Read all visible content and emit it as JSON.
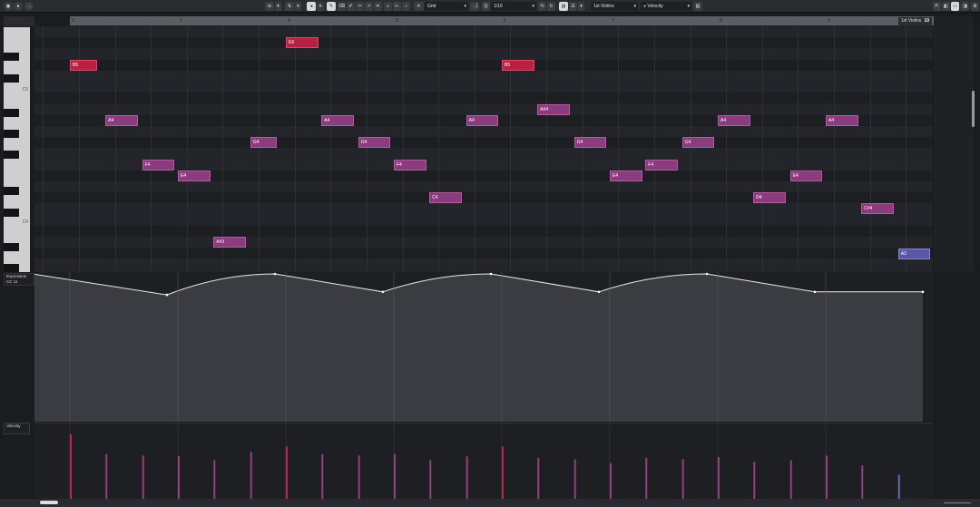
{
  "toolbar": {
    "quantize_value": "Grid",
    "quantize_length": "1/16",
    "track_name": "1st Violins",
    "lane_parameter": "Velocity",
    "active_tool": "draw"
  },
  "ruler": {
    "bars": [
      "2",
      "3",
      "4",
      "5",
      "6",
      "7",
      "8",
      "9"
    ],
    "track_tag_name": "1st Violins",
    "track_tag_number": "10"
  },
  "piano": {
    "labels": [
      "C5",
      "C4"
    ]
  },
  "notes": [
    {
      "label": "B5",
      "bar": 2.0,
      "len": 0.25,
      "pitch": "B5",
      "row": 3.5,
      "color": "red"
    },
    {
      "label": "A4",
      "bar": 2.33,
      "len": 0.3,
      "pitch": "A4",
      "row": 8.5,
      "color": "purple"
    },
    {
      "label": "F4",
      "bar": 2.67,
      "len": 0.3,
      "pitch": "F4",
      "row": 12.5,
      "color": "purple"
    },
    {
      "label": "E4",
      "bar": 3.0,
      "len": 0.3,
      "pitch": "E4",
      "row": 13.5,
      "color": "purple"
    },
    {
      "label": "A#3",
      "bar": 3.33,
      "len": 0.3,
      "pitch": "A#3",
      "row": 19.5,
      "color": "purple"
    },
    {
      "label": "G4",
      "bar": 3.67,
      "len": 0.25,
      "pitch": "G4",
      "row": 10.5,
      "color": "purple"
    },
    {
      "label": "E6",
      "bar": 4.0,
      "len": 0.3,
      "pitch": "E6",
      "row": 1.5,
      "color": "red"
    },
    {
      "label": "A4",
      "bar": 4.33,
      "len": 0.3,
      "pitch": "A4",
      "row": 8.5,
      "color": "purple"
    },
    {
      "label": "G4",
      "bar": 4.67,
      "len": 0.3,
      "pitch": "G4",
      "row": 10.5,
      "color": "purple"
    },
    {
      "label": "F4",
      "bar": 5.0,
      "len": 0.3,
      "pitch": "F4",
      "row": 12.5,
      "color": "purple"
    },
    {
      "label": "C4",
      "bar": 5.33,
      "len": 0.3,
      "pitch": "C4",
      "row": 15.5,
      "color": "purple"
    },
    {
      "label": "A4",
      "bar": 5.67,
      "len": 0.3,
      "pitch": "A4",
      "row": 8.5,
      "color": "purple"
    },
    {
      "label": "B5",
      "bar": 6.0,
      "len": 0.3,
      "pitch": "B5",
      "row": 3.5,
      "color": "red"
    },
    {
      "label": "A#4",
      "bar": 6.33,
      "len": 0.3,
      "pitch": "A#4",
      "row": 7.5,
      "color": "purple"
    },
    {
      "label": "G4",
      "bar": 6.67,
      "len": 0.3,
      "pitch": "G4",
      "row": 10.5,
      "color": "purple"
    },
    {
      "label": "E4",
      "bar": 7.0,
      "len": 0.3,
      "pitch": "E4",
      "row": 13.5,
      "color": "purple"
    },
    {
      "label": "F4",
      "bar": 7.33,
      "len": 0.3,
      "pitch": "F4",
      "row": 12.5,
      "color": "purple"
    },
    {
      "label": "G4",
      "bar": 7.67,
      "len": 0.3,
      "pitch": "G4",
      "row": 10.5,
      "color": "purple"
    },
    {
      "label": "A4",
      "bar": 8.0,
      "len": 0.3,
      "pitch": "A4",
      "row": 8.5,
      "color": "purple"
    },
    {
      "label": "D4",
      "bar": 8.33,
      "len": 0.3,
      "pitch": "D4",
      "row": 15.5,
      "color": "purple"
    },
    {
      "label": "E4",
      "bar": 8.67,
      "len": 0.3,
      "pitch": "E4",
      "row": 13.5,
      "color": "purple"
    },
    {
      "label": "A4",
      "bar": 9.0,
      "len": 0.3,
      "pitch": "A4",
      "row": 8.5,
      "color": "purple"
    },
    {
      "label": "C#4",
      "bar": 9.33,
      "len": 0.3,
      "pitch": "C#4",
      "row": 16.5,
      "color": "purple"
    },
    {
      "label": "A3",
      "bar": 9.67,
      "len": 0.3,
      "pitch": "A3",
      "row": 20.6,
      "color": "blue"
    }
  ],
  "expression": {
    "label_line1": "Expression",
    "label_line2": "CC 11",
    "points": [
      {
        "bar": 1.75,
        "level": 1.0
      },
      {
        "bar": 3.0,
        "level": 0.86
      },
      {
        "bar": 4.0,
        "level": 1.0
      },
      {
        "bar": 5.0,
        "level": 0.88
      },
      {
        "bar": 6.0,
        "level": 1.0
      },
      {
        "bar": 7.0,
        "level": 0.88
      },
      {
        "bar": 8.0,
        "level": 1.0
      },
      {
        "bar": 9.0,
        "level": 0.88
      },
      {
        "bar": 10.0,
        "level": 0.88
      }
    ]
  },
  "velocity": {
    "label": "Velocity",
    "levels": [
      0.86,
      0.6,
      0.58,
      0.57,
      0.52,
      0.63,
      0.7,
      0.6,
      0.58,
      0.6,
      0.52,
      0.57,
      0.7,
      0.55,
      0.53,
      0.48,
      0.55,
      0.53,
      0.56,
      0.5,
      0.52,
      0.58,
      0.45,
      0.33
    ]
  }
}
